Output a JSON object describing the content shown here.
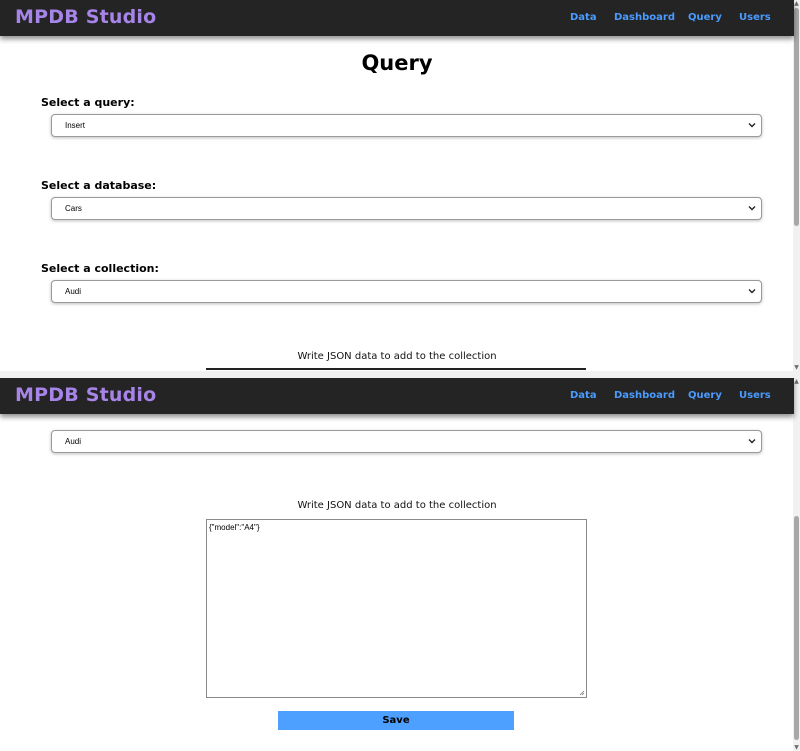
{
  "app": {
    "brand": "MPDB Studio",
    "brand_color": "#a784e8",
    "nav_color": "#4a9bff",
    "nav": [
      "Data",
      "Dashboard",
      "Query",
      "Users"
    ]
  },
  "page": {
    "title": "Query"
  },
  "form": {
    "query_label": "Select a query:",
    "query_value": "Insert",
    "database_label": "Select a database:",
    "database_value": "Cars",
    "collection_label": "Select a collection:",
    "collection_value": "Audi",
    "textarea_caption": "Write JSON data to add to the collection",
    "textarea_value": "{\"model\":\"A4\"}",
    "save_label": "Save",
    "save_color": "#4da0ff"
  },
  "icons": {
    "select_arrow": "chevron-down-icon",
    "resize": "resize-grip-icon"
  }
}
